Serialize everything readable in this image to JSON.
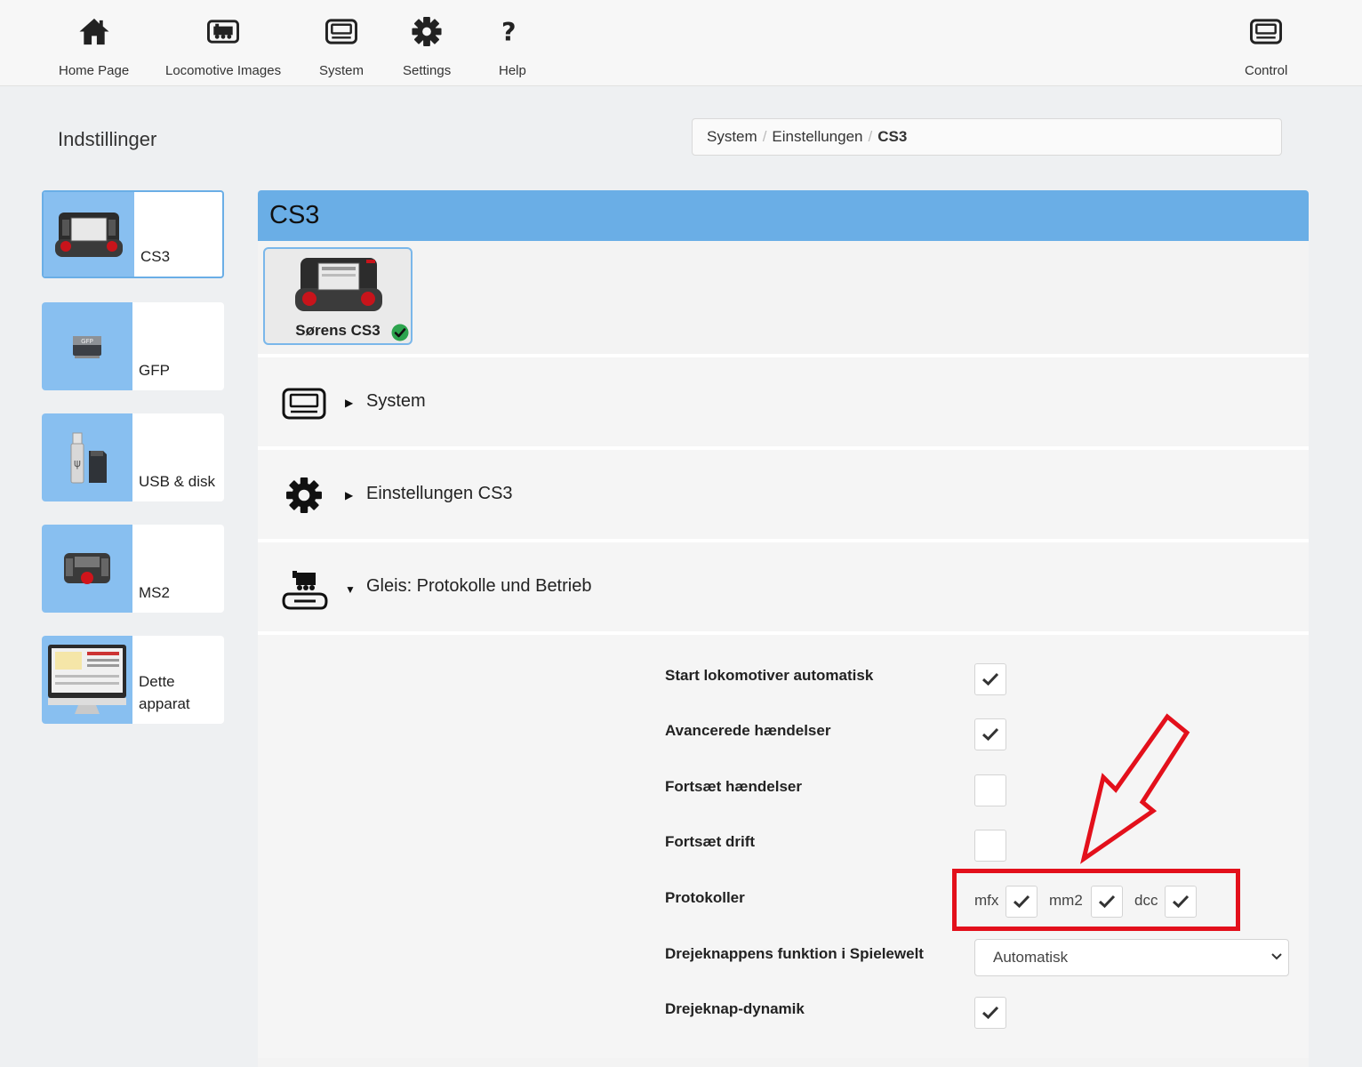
{
  "nav": {
    "items": [
      {
        "label": "Home Page",
        "icon": "home-icon"
      },
      {
        "label": "Locomotive Images",
        "icon": "locomotive-icon"
      },
      {
        "label": "System",
        "icon": "system-icon"
      },
      {
        "label": "Settings",
        "icon": "gear-icon"
      },
      {
        "label": "Help",
        "icon": "question-icon"
      },
      {
        "label": "Control",
        "icon": "control-icon"
      }
    ]
  },
  "page": {
    "title": "Indstillinger"
  },
  "breadcrumb": {
    "items": [
      "System",
      "Einstellungen"
    ],
    "current": "CS3"
  },
  "sidebar": {
    "items": [
      {
        "label": "CS3",
        "icon": "cs3-device-icon",
        "active": true
      },
      {
        "label": "GFP",
        "icon": "gfp-chip-icon"
      },
      {
        "label": "USB & disk",
        "icon": "usb-disk-icon"
      },
      {
        "label": "MS2",
        "icon": "ms2-controller-icon"
      },
      {
        "label": "Dette apparat",
        "icon": "monitor-icon"
      }
    ]
  },
  "panel": {
    "title": "CS3",
    "device": {
      "name": "Sørens CS3",
      "status": "connected"
    },
    "sections": [
      {
        "label": "System",
        "icon": "system-icon",
        "expanded": false
      },
      {
        "label": "Einstellungen CS3",
        "icon": "gear-icon",
        "expanded": false
      },
      {
        "label": "Gleis: Protokolle und Betrieb",
        "icon": "track-locomotive-icon",
        "expanded": true
      }
    ],
    "settings": {
      "start_auto": {
        "label": "Start lokomotiver automatisk",
        "checked": true
      },
      "advanced_events": {
        "label": "Avancerede hændelser",
        "checked": true
      },
      "continue_events": {
        "label": "Fortsæt hændelser",
        "checked": false
      },
      "continue_operation": {
        "label": "Fortsæt drift",
        "checked": false
      },
      "protocols": {
        "label": "Protokoller",
        "items": [
          {
            "label": "mfx",
            "checked": true
          },
          {
            "label": "mm2",
            "checked": true
          },
          {
            "label": "dcc",
            "checked": true
          }
        ]
      },
      "knob_function": {
        "label": "Drejeknappens funktion i Spielewelt",
        "value": "Automatisk"
      },
      "knob_dynamic": {
        "label": "Drejeknap-dynamik",
        "checked": true
      }
    }
  },
  "annotation": {
    "color": "#e3101b"
  }
}
